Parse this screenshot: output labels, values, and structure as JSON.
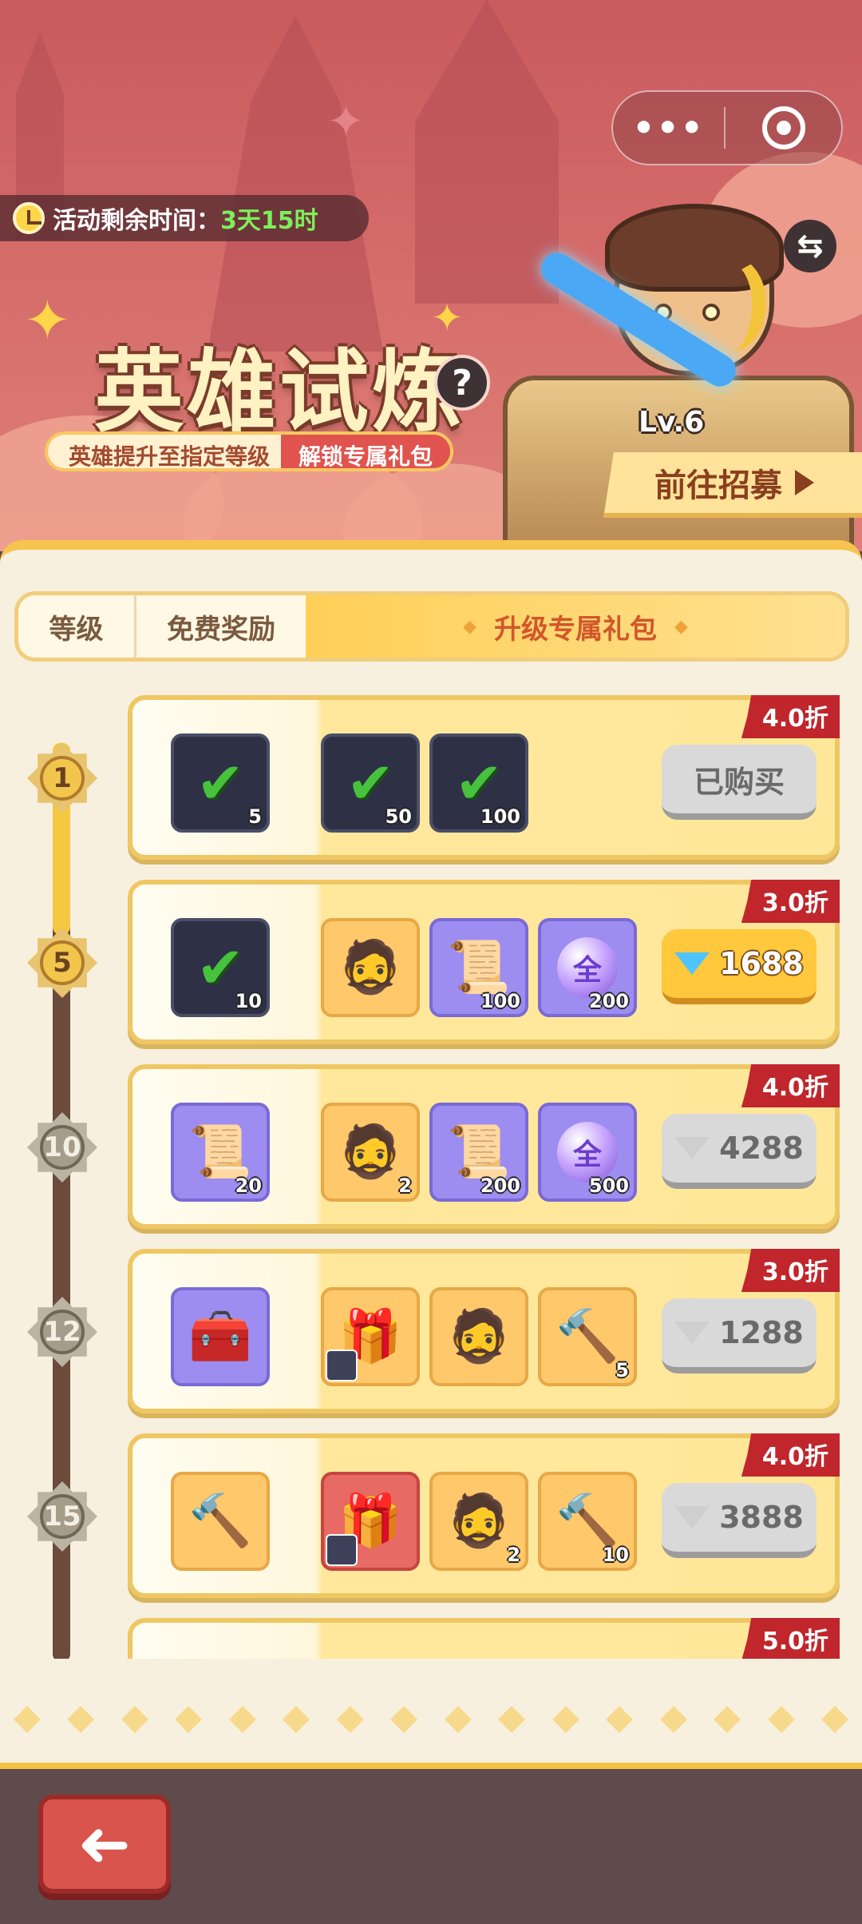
{
  "header": {
    "timer_label": "活动剩余时间：",
    "timer_value": "3天15时",
    "title": "英雄试炼",
    "subtitle_left": "英雄提升至指定等级",
    "subtitle_right": "解锁专属礼包",
    "hero_level": "Lv.6",
    "recruit_button": "前往招募",
    "menu_dots": "•••",
    "help_icon": "?",
    "swap_icon": "⇆"
  },
  "tabs": [
    {
      "label": "等级"
    },
    {
      "label": "免费奖励"
    },
    {
      "label": "升级专属礼包",
      "active": true
    }
  ],
  "tiers": [
    {
      "level": "1",
      "discount": "4.0折",
      "button": "已购买",
      "button_style": "gray",
      "gem": false,
      "items": [
        {
          "type": "integral-card",
          "qty": "5",
          "claimed": true
        },
        {
          "type": "integral-card",
          "qty": "50",
          "claimed": true
        },
        {
          "type": "orb",
          "qty": "100",
          "claimed": true
        }
      ]
    },
    {
      "level": "5",
      "discount": "3.0折",
      "button": "1688",
      "button_style": "gold",
      "gem": true,
      "items": [
        {
          "type": "integral-card",
          "qty": "10",
          "claimed": true
        },
        {
          "type": "hero-portrait",
          "qty": ""
        },
        {
          "type": "integral-card",
          "qty": "100"
        },
        {
          "type": "orb",
          "qty": "200",
          "label": "全"
        }
      ]
    },
    {
      "level": "10",
      "discount": "4.0折",
      "button": "4288",
      "button_style": "gray",
      "gem": true,
      "items": [
        {
          "type": "integral-card",
          "qty": "20"
        },
        {
          "type": "hero-portrait",
          "qty": "2"
        },
        {
          "type": "integral-card",
          "qty": "200"
        },
        {
          "type": "orb",
          "qty": "500",
          "label": "全"
        }
      ]
    },
    {
      "level": "12",
      "discount": "3.0折",
      "button": "1288",
      "button_style": "gray",
      "gem": true,
      "items": [
        {
          "type": "treasure-chest",
          "qty": ""
        },
        {
          "type": "mystery-chest",
          "qty": ""
        },
        {
          "type": "hero-portrait",
          "qty": ""
        },
        {
          "type": "hammer",
          "qty": "5"
        }
      ]
    },
    {
      "level": "15",
      "discount": "4.0折",
      "button": "3888",
      "button_style": "gray",
      "gem": true,
      "items": [
        {
          "type": "hammer",
          "qty": ""
        },
        {
          "type": "mystery-chest",
          "qty": ""
        },
        {
          "type": "hero-portrait",
          "qty": "2"
        },
        {
          "type": "hammer",
          "qty": "10"
        }
      ]
    },
    {
      "level": "",
      "discount": "5.0折",
      "button": "",
      "button_style": "gray",
      "gem": false,
      "items": []
    }
  ],
  "colors": {
    "accent_gold": "#f7c44e",
    "discount_red": "#c0262c",
    "tab_active_text": "#d2562b",
    "timer_green": "#7cf05a",
    "banner_red": "#d46b69"
  },
  "footer": {
    "back_icon": "➜"
  }
}
